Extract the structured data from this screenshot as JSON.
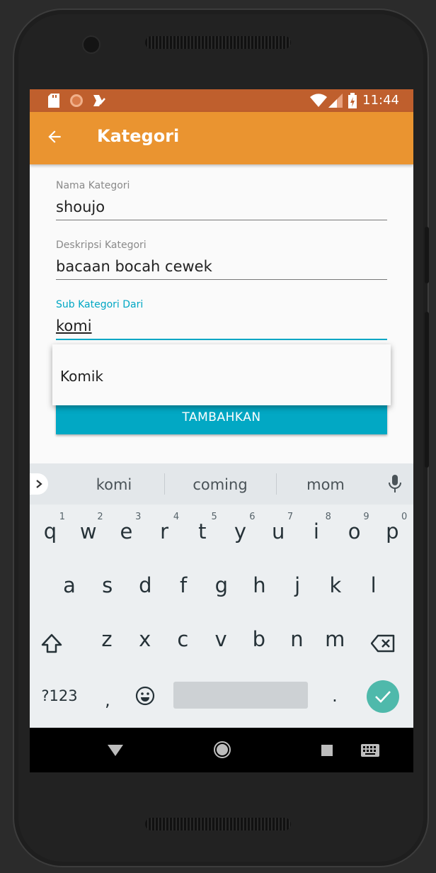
{
  "status_bar": {
    "time": "11:44"
  },
  "app_bar": {
    "title": "Kategori"
  },
  "form": {
    "name": {
      "label": "Nama Kategori",
      "value": "shoujo"
    },
    "description": {
      "label": "Deskripsi Kategori",
      "value": "bacaan bocah cewek"
    },
    "parent": {
      "label": "Sub Kategori Dari",
      "value": "komi"
    },
    "submit_label": "TAMBAHKAN"
  },
  "dropdown": {
    "items": [
      "Komik"
    ]
  },
  "keyboard": {
    "suggestions": [
      "komi",
      "coming",
      "mom"
    ],
    "row1": [
      "q",
      "w",
      "e",
      "r",
      "t",
      "y",
      "u",
      "i",
      "o",
      "p"
    ],
    "row1_hints": [
      "1",
      "2",
      "3",
      "4",
      "5",
      "6",
      "7",
      "8",
      "9",
      "0"
    ],
    "row2": [
      "a",
      "s",
      "d",
      "f",
      "g",
      "h",
      "j",
      "k",
      "l"
    ],
    "row3": [
      "z",
      "x",
      "c",
      "v",
      "b",
      "n",
      "m"
    ],
    "symbols_label": "?123",
    "comma": ",",
    "period": "."
  },
  "colors": {
    "status_bar": "#bf5f2d",
    "app_bar": "#ea9430",
    "accent": "#00a7c4",
    "enter": "#4fb9ab"
  }
}
